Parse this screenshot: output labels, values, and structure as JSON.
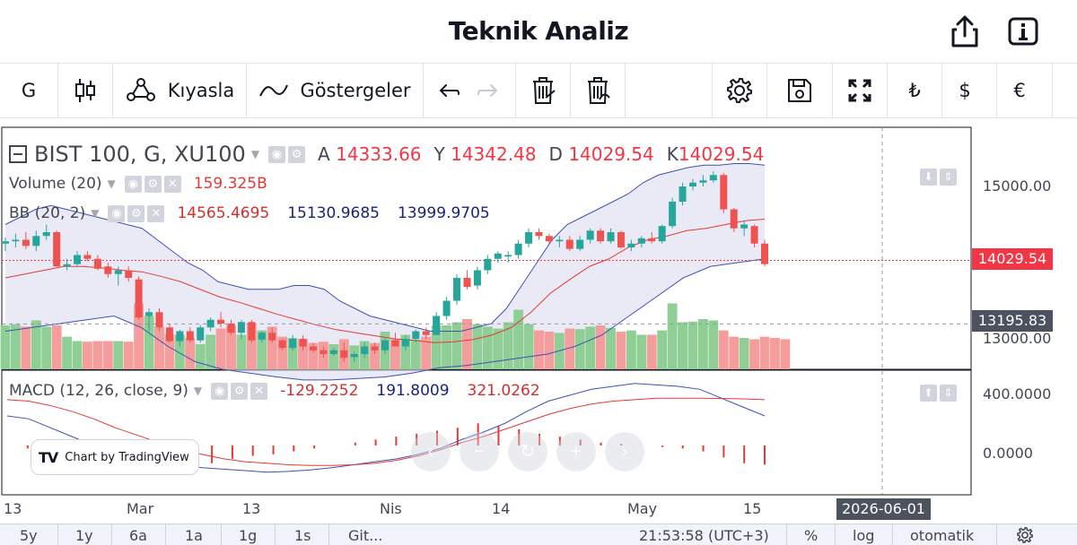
{
  "header": {
    "title": "Teknik Analiz",
    "share_icon": "share-icon",
    "info_icon": "info-icon"
  },
  "toolbar": {
    "interval": "G",
    "compare_label": "Kıyasla",
    "indicators_label": "Göstergeler",
    "currency_try": "₺",
    "currency_usd": "$",
    "currency_eur": "€"
  },
  "legend": {
    "symbol": "BIST 100, G, XU100",
    "ohlc": [
      {
        "k": "A",
        "v": "14333.66"
      },
      {
        "k": "Y",
        "v": "14342.48"
      },
      {
        "k": "D",
        "v": "14029.54"
      },
      {
        "k": "K",
        "v": "14029.54"
      }
    ],
    "volume_name": "Volume (20)",
    "volume_value": "159.325B",
    "bb_name": "BB (20, 2)",
    "bb_values": [
      "14565.4695",
      "15130.9685",
      "13999.9705"
    ],
    "macd_name": "MACD (12, 26, close, 9)",
    "macd_values": [
      "-129.2252",
      "191.8009",
      "321.0262"
    ]
  },
  "price_axis": {
    "ticks": [
      "15000.00",
      "13000.00"
    ],
    "last_price": "14029.54",
    "crosshair_price": "13195.83"
  },
  "macd_axis": {
    "ticks": [
      "400.0000",
      "0.0000"
    ]
  },
  "time_axis": {
    "labels": [
      "13",
      "Mar",
      "13",
      "Nis",
      "14",
      "May",
      "15"
    ],
    "crosshair_date": "2026-06-01"
  },
  "badge": {
    "logo": "TV",
    "text": "Chart by TradingView"
  },
  "bottombar": {
    "ranges": [
      "5y",
      "1y",
      "6a",
      "1a",
      "1g",
      "1s"
    ],
    "goto": "Git...",
    "clock": "21:53:58 (UTC+3)",
    "percent": "%",
    "log": "log",
    "auto": "otomatik"
  },
  "colors": {
    "up": "#26a69a",
    "down": "#ef5350",
    "vol_up": "#8fcf96",
    "vol_down": "#f59c9c",
    "bb_fill": "#dcdcf2",
    "price_red": "#f23645"
  },
  "chart_data": [
    {
      "type": "candlestick",
      "title": "BIST 100, G, XU100",
      "x_axis_ticks": [
        "13",
        "Mar",
        "13",
        "Nis",
        "14",
        "May",
        "15"
      ],
      "ylim": [
        12700,
        15400
      ],
      "candles": [
        [
          14250,
          14330,
          14150,
          14280
        ],
        [
          14280,
          14380,
          14200,
          14300
        ],
        [
          14300,
          14400,
          14180,
          14220
        ],
        [
          14220,
          14420,
          14150,
          14350
        ],
        [
          14350,
          14500,
          14300,
          14400
        ],
        [
          14400,
          14420,
          13950,
          13950
        ],
        [
          13950,
          14050,
          13900,
          13980
        ],
        [
          13980,
          14150,
          13950,
          14100
        ],
        [
          14100,
          14150,
          14020,
          14050
        ],
        [
          14050,
          14100,
          13900,
          13920
        ],
        [
          13950,
          14000,
          13800,
          13850
        ],
        [
          13850,
          13950,
          13700,
          13900
        ],
        [
          13900,
          13950,
          13750,
          13800
        ],
        [
          13780,
          13820,
          13250,
          13280
        ],
        [
          13300,
          13400,
          13100,
          13350
        ],
        [
          13350,
          13400,
          13100,
          13150
        ],
        [
          13150,
          13200,
          12950,
          12970
        ],
        [
          12970,
          13120,
          12900,
          13100
        ],
        [
          13100,
          13150,
          12950,
          12980
        ],
        [
          12980,
          13180,
          12950,
          13150
        ],
        [
          13150,
          13280,
          13100,
          13250
        ],
        [
          13250,
          13350,
          13150,
          13200
        ],
        [
          13200,
          13250,
          13050,
          13080
        ],
        [
          13080,
          13250,
          13000,
          13220
        ],
        [
          13220,
          13250,
          12950,
          12980
        ],
        [
          12990,
          13100,
          12950,
          13080
        ],
        [
          13080,
          13150,
          12950,
          12980
        ],
        [
          12980,
          13000,
          12850,
          12880
        ],
        [
          12880,
          13050,
          12850,
          13000
        ],
        [
          13000,
          13050,
          12850,
          12900
        ],
        [
          12900,
          12950,
          12820,
          12850
        ],
        [
          12850,
          12900,
          12750,
          12800
        ],
        [
          12800,
          12880,
          12780,
          12850
        ],
        [
          12850,
          12950,
          12700,
          12750
        ],
        [
          12760,
          12830,
          12700,
          12800
        ],
        [
          12800,
          12950,
          12750,
          12900
        ],
        [
          12900,
          12950,
          12800,
          12850
        ],
        [
          12850,
          13000,
          12800,
          12980
        ],
        [
          12980,
          13080,
          12900,
          12900
        ],
        [
          12900,
          13050,
          12850,
          13000
        ],
        [
          13000,
          13120,
          12950,
          13100
        ],
        [
          13100,
          13150,
          13000,
          13050
        ],
        [
          13050,
          13350,
          13050,
          13300
        ],
        [
          13300,
          13550,
          13250,
          13500
        ],
        [
          13500,
          13850,
          13450,
          13800
        ],
        [
          13800,
          13900,
          13650,
          13680
        ],
        [
          13700,
          13950,
          13650,
          13900
        ],
        [
          13900,
          14100,
          13850,
          14050
        ],
        [
          14050,
          14150,
          14000,
          14120
        ],
        [
          14080,
          14150,
          14000,
          14100
        ],
        [
          14100,
          14300,
          14050,
          14250
        ],
        [
          14250,
          14450,
          14200,
          14400
        ],
        [
          14400,
          14450,
          14300,
          14350
        ],
        [
          14350,
          14380,
          14250,
          14280
        ],
        [
          14280,
          14350,
          14200,
          14300
        ],
        [
          14300,
          14350,
          14150,
          14180
        ],
        [
          14180,
          14350,
          14150,
          14300
        ],
        [
          14300,
          14450,
          14250,
          14420
        ],
        [
          14420,
          14450,
          14250,
          14280
        ],
        [
          14280,
          14450,
          14250,
          14400
        ],
        [
          14400,
          14420,
          14180,
          14200
        ],
        [
          14200,
          14300,
          14150,
          14250
        ],
        [
          14250,
          14350,
          14200,
          14320
        ],
        [
          14320,
          14400,
          14250,
          14280
        ],
        [
          14280,
          14500,
          14250,
          14480
        ],
        [
          14480,
          14850,
          14450,
          14800
        ],
        [
          14800,
          15050,
          14750,
          15000
        ],
        [
          15000,
          15100,
          14950,
          15050
        ],
        [
          15050,
          15150,
          15000,
          15080
        ],
        [
          15080,
          15200,
          15050,
          15150
        ],
        [
          15150,
          15180,
          14650,
          14700
        ],
        [
          14700,
          14720,
          14400,
          14450
        ],
        [
          14450,
          14550,
          14350,
          14500
        ],
        [
          14480,
          14500,
          14200,
          14250
        ],
        [
          14250,
          14300,
          13950,
          13980
        ]
      ],
      "bb_upper": [
        14500,
        14600,
        14700,
        14750,
        14700,
        14650,
        14600,
        14550,
        14500,
        14450,
        14300,
        14150,
        14000,
        13900,
        13750,
        13700,
        13650,
        13650,
        13650,
        13700,
        13700,
        13650,
        13500,
        13400,
        13300,
        13250,
        13200,
        13150,
        13100,
        13100,
        13100,
        13150,
        13200,
        13400,
        13700,
        14000,
        14300,
        14500,
        14600,
        14700,
        14800,
        14900,
        15050,
        15150,
        15200,
        15250,
        15280,
        15280,
        15300,
        15300,
        15280
      ],
      "bb_mid": [
        13800,
        13850,
        13900,
        13950,
        13950,
        13930,
        13900,
        13880,
        13820,
        13750,
        13650,
        13550,
        13480,
        13400,
        13320,
        13250,
        13180,
        13120,
        13080,
        13040,
        13000,
        12980,
        12950,
        12960,
        12990,
        13050,
        13150,
        13350,
        13600,
        13780,
        13950,
        14050,
        14200,
        14300,
        14350,
        14420,
        14450,
        14500,
        14550,
        14570
      ],
      "bb_lower": [
        13100,
        13150,
        13200,
        13250,
        13300,
        13150,
        12900,
        12700,
        12600,
        12550,
        12500,
        12460,
        12460,
        12480,
        12500,
        12550,
        12620,
        12650,
        12700,
        12750,
        12800,
        12900,
        13050,
        13300,
        13550,
        13800,
        13950,
        14000,
        14050
      ],
      "volume": [
        0.7,
        0.72,
        0.68,
        0.78,
        0.68,
        0.7,
        0.52,
        0.45,
        0.44,
        0.45,
        0.45,
        0.45,
        0.44,
        1.05,
        0.85,
        0.68,
        0.56,
        0.55,
        0.5,
        0.4,
        0.55,
        0.65,
        0.7,
        0.55,
        0.72,
        0.62,
        0.68,
        0.52,
        0.5,
        0.48,
        0.42,
        0.44,
        0.4,
        0.48,
        0.38,
        0.45,
        0.42,
        0.6,
        0.48,
        0.55,
        0.48,
        0.52,
        0.7,
        0.7,
        0.75,
        0.8,
        0.72,
        0.68,
        0.65,
        0.75,
        0.95,
        0.72,
        0.62,
        0.6,
        0.58,
        0.65,
        0.64,
        0.68,
        0.7,
        0.66,
        0.6,
        0.62,
        0.55,
        0.55,
        0.62,
        1.05,
        0.75,
        0.76,
        0.8,
        0.78,
        0.62,
        0.52,
        0.5,
        0.48,
        0.52,
        0.5,
        0.48
      ]
    },
    {
      "type": "line",
      "title": "MACD (12, 26, close, 9)",
      "ylim": [
        -150,
        450
      ],
      "series": [
        {
          "name": "MACD",
          "values": [
            200,
            180,
            120,
            60,
            0,
            -50,
            -90,
            -110,
            -130,
            -150,
            -160,
            -170,
            -180,
            -175,
            -165,
            -150,
            -130,
            -110,
            -90,
            -60,
            -20,
            40,
            90,
            150,
            230,
            300,
            340,
            380,
            400,
            420,
            410,
            400,
            380,
            320,
            260,
            200
          ]
        },
        {
          "name": "Signal",
          "values": [
            310,
            300,
            270,
            230,
            180,
            120,
            70,
            20,
            -20,
            -60,
            -90,
            -110,
            -120,
            -130,
            -135,
            -135,
            -130,
            -120,
            -100,
            -70,
            -30,
            20,
            60,
            110,
            160,
            210,
            250,
            280,
            300,
            310,
            320,
            320,
            320,
            318,
            315,
            310
          ]
        }
      ],
      "histogram": [
        0,
        -20,
        -40,
        -60,
        -90,
        -120,
        -140,
        -150,
        -150,
        -140,
        -120,
        -90,
        -70,
        -60,
        -40,
        -20,
        0,
        20,
        40,
        60,
        80,
        100,
        120,
        150,
        130,
        110,
        80,
        60,
        40,
        20,
        10,
        0,
        -10,
        -20,
        -40,
        -80,
        -120,
        -130
      ]
    }
  ]
}
